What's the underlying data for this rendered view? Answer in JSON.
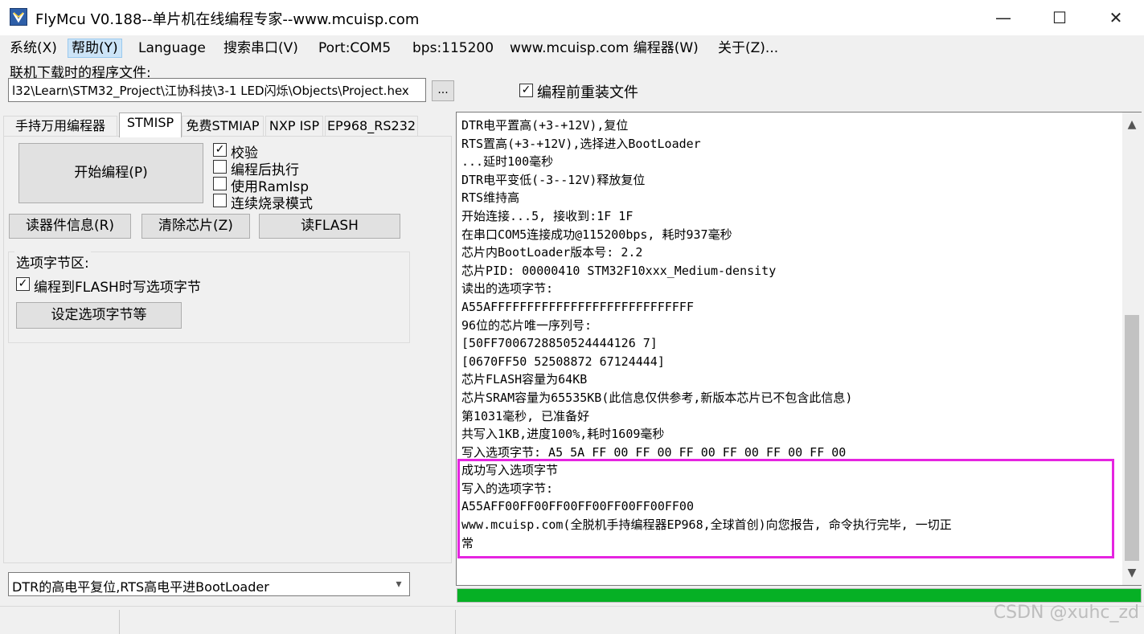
{
  "window": {
    "title": "FlyMcu V0.188--单片机在线编程专家--www.mcuisp.com",
    "minimize": "—",
    "maximize": "☐",
    "close": "✕"
  },
  "menu": [
    "系统(X)",
    "帮助(Y)",
    "Language",
    "搜索串口(V)",
    "Port:COM5",
    "bps:115200",
    "www.mcuisp.com 编程器(W)",
    "关于(Z)..."
  ],
  "file": {
    "label": "联机下载时的程序文件:",
    "path": "l32\\Learn\\STM32_Project\\江协科技\\3-1 LED闪烁\\Objects\\Project.hex",
    "browse": "...",
    "reload_label": "编程前重装文件",
    "reload_checked": "✓"
  },
  "tabs": [
    "手持万用编程器",
    "STMISP",
    "免费STMIAP",
    "NXP ISP",
    "EP968_RS232"
  ],
  "stmisp": {
    "start_button": "开始编程(P)",
    "options": [
      {
        "label": "校验",
        "mark": "✓"
      },
      {
        "label": "编程后执行",
        "mark": ""
      },
      {
        "label": "使用RamIsp",
        "mark": ""
      },
      {
        "label": "连续烧录模式",
        "mark": ""
      }
    ],
    "read_info": "读器件信息(R)",
    "erase_chip": "清除芯片(Z)",
    "read_flash": "读FLASH",
    "option_group_title": "选项字节区:",
    "write_option_label": "编程到FLASH时写选项字节",
    "write_option_mark": "✓",
    "set_option_button": "设定选项字节等"
  },
  "reset_mode": "DTR的高电平复位,RTS高电平进BootLoader",
  "log": [
    "DTR电平置高(+3-+12V),复位",
    "RTS置高(+3-+12V),选择进入BootLoader",
    "...延时100毫秒",
    "DTR电平变低(-3--12V)释放复位",
    "RTS维持高",
    "开始连接...5, 接收到:1F 1F",
    "在串口COM5连接成功@115200bps, 耗时937毫秒",
    "芯片内BootLoader版本号: 2.2",
    "芯片PID: 00000410  STM32F10xxx_Medium-density",
    "读出的选项字节:",
    "A55AFFFFFFFFFFFFFFFFFFFFFFFFFFFF",
    "96位的芯片唯一序列号:",
    "[50FF7006728850524444126 7]",
    "[0670FF50 52508872 67124444]",
    "芯片FLASH容量为64KB",
    "芯片SRAM容量为65535KB(此信息仅供参考,新版本芯片已不包含此信息)",
    "第1031毫秒, 已准备好",
    "共写入1KB,进度100%,耗时1609毫秒",
    "写入选项字节:  A5 5A FF 00 FF 00 FF 00 FF 00 FF 00 FF 00",
    "成功写入选项字节",
    "写入的选项字节:",
    "A55AFF00FF00FF00FF00FF00FF00FF00",
    "www.mcuisp.com(全脱机手持编程器EP968,全球首创)向您报告, 命令执行完毕, 一切正",
    "常"
  ],
  "progress": 1.0,
  "colors": {
    "progress": "#06b025",
    "highlight": "#e524e0"
  },
  "watermark": "CSDN @xuhc_zd"
}
